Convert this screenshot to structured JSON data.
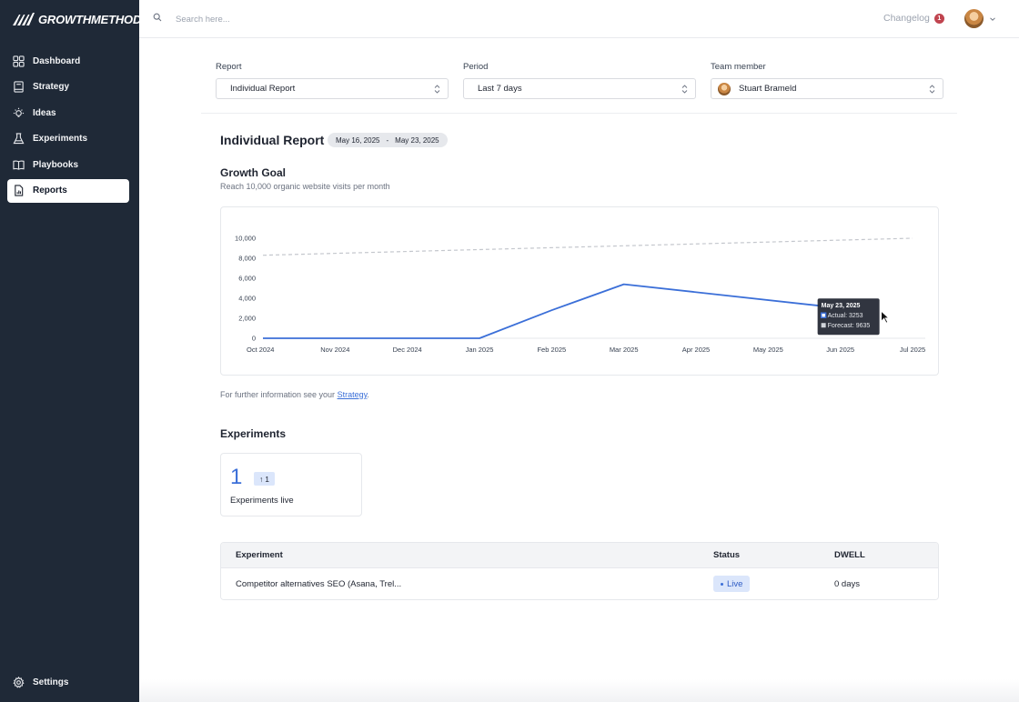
{
  "brand": {
    "name": "GROWTHMETHOD"
  },
  "sidebar": {
    "items": [
      {
        "label": "Dashboard",
        "icon": "grid-icon"
      },
      {
        "label": "Strategy",
        "icon": "book-icon"
      },
      {
        "label": "Ideas",
        "icon": "lightbulb-icon"
      },
      {
        "label": "Experiments",
        "icon": "flask-icon"
      },
      {
        "label": "Playbooks",
        "icon": "open-book-icon"
      },
      {
        "label": "Reports",
        "icon": "report-icon",
        "active": true
      }
    ],
    "settings_label": "Settings"
  },
  "topbar": {
    "search_placeholder": "Search here...",
    "changelog_label": "Changelog",
    "changelog_count": "1"
  },
  "filters": {
    "report": {
      "label": "Report",
      "value": "Individual Report"
    },
    "period": {
      "label": "Period",
      "value": "Last 7 days"
    },
    "team_member": {
      "label": "Team member",
      "value": "Stuart Brameld"
    }
  },
  "report": {
    "title": "Individual Report",
    "date_start": "May 16, 2025",
    "date_sep": "-",
    "date_end": "May 23, 2025"
  },
  "goal": {
    "title": "Growth Goal",
    "subtitle": "Reach 10,000 organic website visits per month"
  },
  "chart_data": {
    "type": "line",
    "x": [
      "Oct 2024",
      "Nov 2024",
      "Dec 2024",
      "Jan 2025",
      "Feb 2025",
      "Mar 2025",
      "Apr 2025",
      "May 2025",
      "Jun 2025",
      "Jul 2025"
    ],
    "ylim": [
      0,
      10000
    ],
    "yticks": [
      "10,000",
      "8,000",
      "6,000",
      "4,000",
      "2,000",
      "0"
    ],
    "grid": false,
    "series": [
      {
        "name": "Actual",
        "color": "#3b6fd8",
        "style": "solid",
        "points": [
          [
            "Oct 2024",
            0
          ],
          [
            "Nov 2024",
            0
          ],
          [
            "Dec 2024",
            0
          ],
          [
            "Jan 2025",
            0
          ],
          [
            "Feb 2025",
            2800
          ],
          [
            "Mar 2025",
            5400
          ],
          [
            "May 23, 2025",
            3253
          ]
        ]
      },
      {
        "name": "Forecast",
        "color": "#c4c7cd",
        "style": "dashed",
        "points": [
          [
            "Oct 2024",
            8300
          ],
          [
            "Jul 2025",
            10000
          ]
        ]
      }
    ],
    "tooltip": {
      "title": "May 23, 2025",
      "actual_label": "Actual: 3253",
      "forecast_label": "Forecast: 9635"
    }
  },
  "further": {
    "prefix": "For further information see your ",
    "link": "Strategy",
    "suffix": "."
  },
  "experiments": {
    "title": "Experiments",
    "live_count": "1",
    "delta": "1",
    "live_label": "Experiments live",
    "table": {
      "headers": [
        "Experiment",
        "Status",
        "DWELL"
      ],
      "rows": [
        {
          "name": "Competitor alternatives SEO (Asana, Trel...",
          "status": "Live",
          "dwell": "0 days"
        }
      ]
    }
  }
}
